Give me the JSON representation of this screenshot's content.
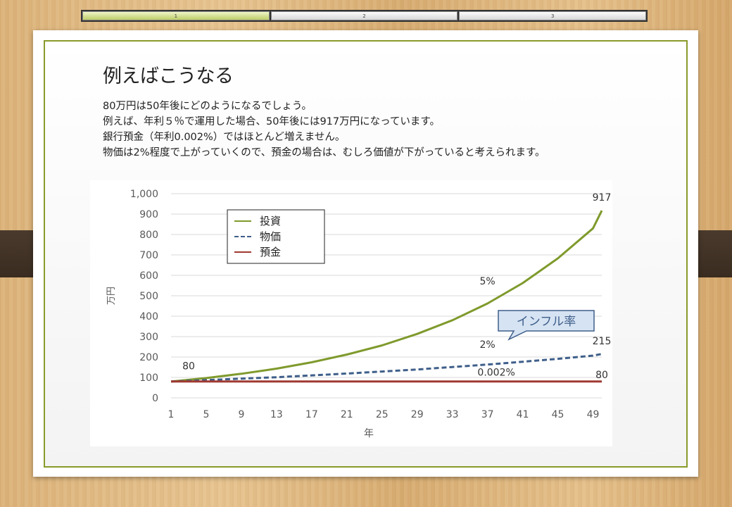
{
  "progress_tabs": [
    "1",
    "2",
    "3"
  ],
  "slide": {
    "title": "例えばこうなる",
    "lines": [
      "80万円は50年後にどのようになるでしょう。",
      "例えば、年利５％で運用した場合、50年後には917万円になっています。",
      "銀行預金（年利0.002%）ではほとんど増えません。",
      "物価は2%程度で上がっていくので、預金の場合は、むしろ価値が下がっていると考えられます。"
    ]
  },
  "chart_data": {
    "type": "line",
    "title": "",
    "xlabel": "年",
    "ylabel": "万円",
    "x_ticks": [
      1,
      5,
      9,
      13,
      17,
      21,
      25,
      29,
      33,
      37,
      41,
      45,
      49
    ],
    "ylim": [
      0,
      1000
    ],
    "y_ticks": [
      "0",
      "100",
      "200",
      "300",
      "400",
      "500",
      "600",
      "700",
      "800",
      "900",
      "1,000"
    ],
    "grid": true,
    "legend_position": "top-left",
    "x": [
      1,
      5,
      9,
      13,
      17,
      21,
      25,
      29,
      33,
      37,
      41,
      45,
      49,
      50
    ],
    "series": [
      {
        "name": "投資",
        "color": "#7f9a2c",
        "style": "solid",
        "values": [
          80,
          97,
          118,
          143,
          174,
          212,
          257,
          313,
          380,
          462,
          562,
          683,
          830,
          917
        ]
      },
      {
        "name": "物価",
        "color": "#3f5f8a",
        "style": "dashed",
        "values": [
          80,
          87,
          94,
          101,
          110,
          119,
          129,
          139,
          151,
          163,
          177,
          191,
          207,
          215
        ]
      },
      {
        "name": "預金",
        "color": "#a03a32",
        "style": "solid",
        "values": [
          80,
          80,
          80,
          80,
          80,
          80,
          80,
          80,
          80,
          80,
          80,
          80,
          80,
          80
        ]
      }
    ],
    "data_labels": [
      {
        "text": "80",
        "x": 3,
        "y": 140
      },
      {
        "text": "917",
        "x": 50,
        "y": 965
      },
      {
        "text": "5%",
        "x": 37,
        "y": 555
      },
      {
        "text": "2%",
        "x": 37,
        "y": 245
      },
      {
        "text": "215",
        "x": 50,
        "y": 262
      },
      {
        "text": "0.002%",
        "x": 38,
        "y": 108
      },
      {
        "text": "80",
        "x": 50,
        "y": 97
      }
    ],
    "callout": {
      "text": "インフル率",
      "fill": "#d6e3f3",
      "stroke": "#3f5f8a"
    }
  }
}
